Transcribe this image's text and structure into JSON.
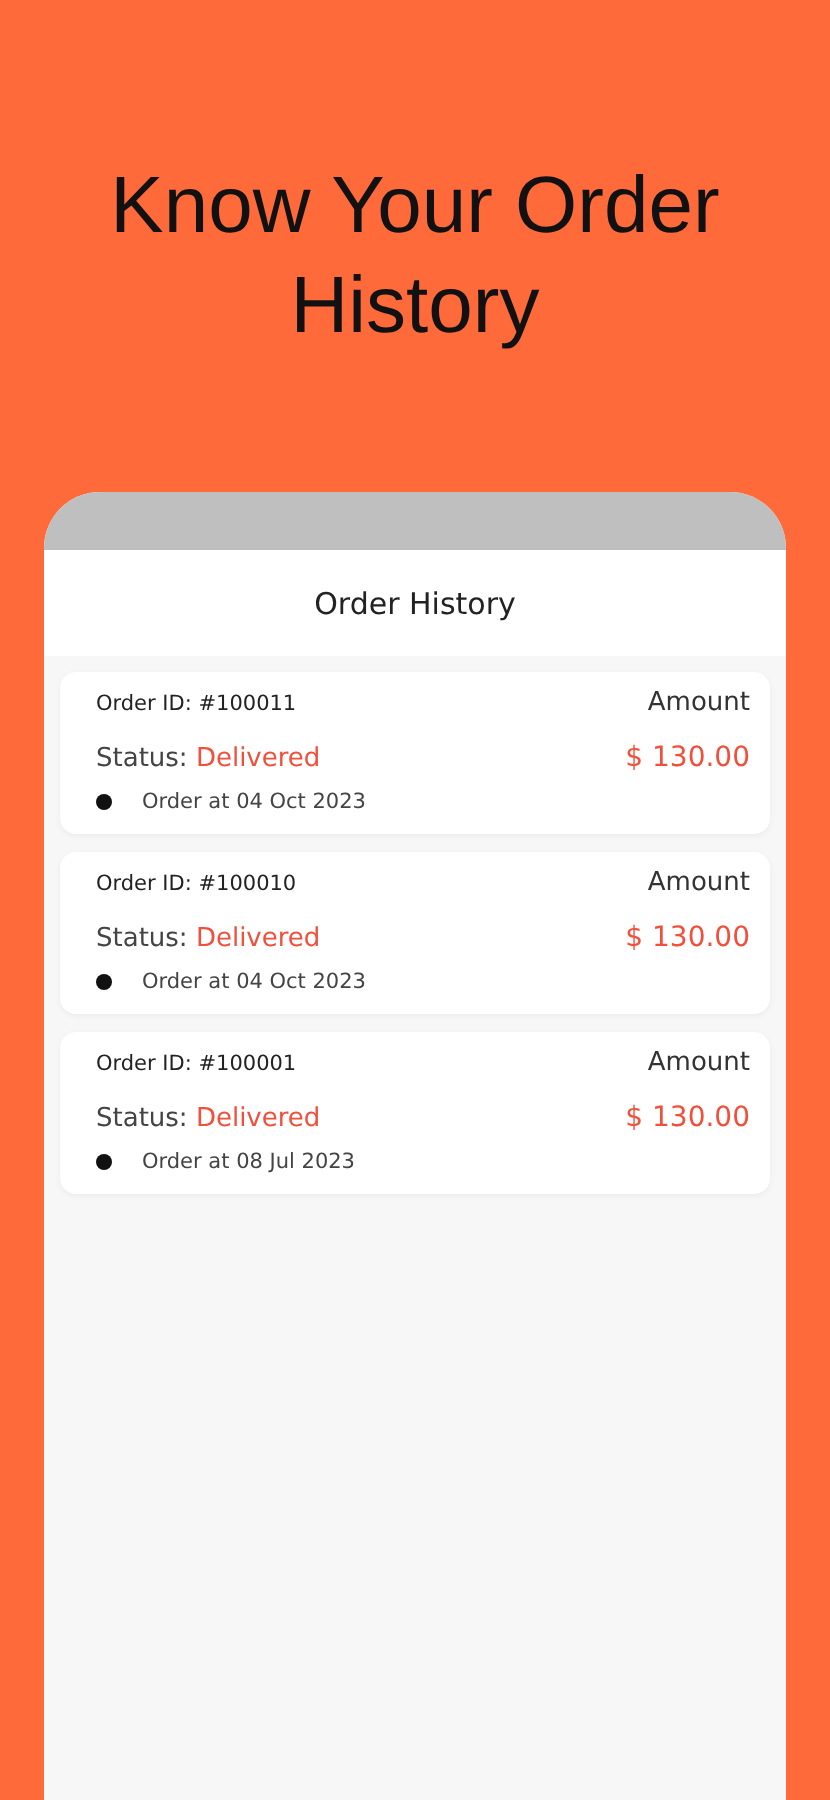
{
  "headline": "Know Your Order History",
  "screen": {
    "title": "Order History",
    "orders": [
      {
        "id_text": "Order ID: #100011",
        "amount_label": "Amount",
        "status_label": "Status:",
        "status": "Delivered",
        "amount": "$ 130.00",
        "date": "Order at 04 Oct 2023"
      },
      {
        "id_text": "Order ID: #100010",
        "amount_label": "Amount",
        "status_label": "Status:",
        "status": "Delivered",
        "amount": "$ 130.00",
        "date": "Order at 04 Oct 2023"
      },
      {
        "id_text": "Order ID: #100001",
        "amount_label": "Amount",
        "status_label": "Status:",
        "status": "Delivered",
        "amount": "$ 130.00",
        "date": "Order at 08 Jul 2023"
      }
    ]
  }
}
